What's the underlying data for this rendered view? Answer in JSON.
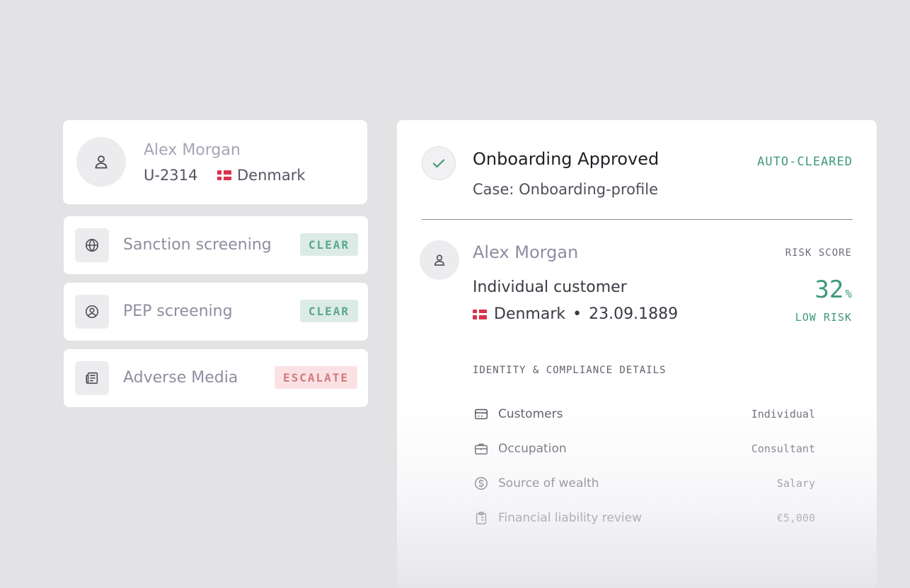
{
  "profile": {
    "name": "Alex Morgan",
    "user_id": "U-2314",
    "country": "Denmark",
    "avatar_icon": "user-icon",
    "flag_icon": "denmark-flag-icon"
  },
  "screenings": [
    {
      "label": "Sanction screening",
      "status": "CLEAR",
      "icon": "globe-icon",
      "status_color": "#5aa88a"
    },
    {
      "label": "PEP screening",
      "status": "CLEAR",
      "icon": "user-circle-icon",
      "status_color": "#5aa88a"
    },
    {
      "label": "Adverse Media",
      "status": "ESCALATE",
      "icon": "newspaper-icon",
      "status_color": "#d27a7d"
    }
  ],
  "approval": {
    "title": "Onboarding Approved",
    "case": "Case: Onboarding-profile",
    "tag": "AUTO-CLEARED",
    "icon": "check-icon"
  },
  "customer": {
    "name": "Alex Morgan",
    "type": "Individual customer",
    "country": "Denmark",
    "separator": "•",
    "dob": "23.09.1889"
  },
  "risk": {
    "label": "RISK SCORE",
    "score": "32",
    "unit": "%",
    "level": "LOW RISK",
    "color": "#3f9a78"
  },
  "details": {
    "heading": "IDENTITY & COMPLIANCE DETAILS",
    "rows": [
      {
        "label": "Customers",
        "value": "Individual",
        "icon": "id-card-icon"
      },
      {
        "label": "Occupation",
        "value": "Consultant",
        "icon": "briefcase-icon"
      },
      {
        "label": "Source of wealth",
        "value": "Salary",
        "icon": "dollar-circle-icon"
      },
      {
        "label": "Financial liability review",
        "value": "€5,000",
        "icon": "clipboard-icon"
      }
    ]
  }
}
